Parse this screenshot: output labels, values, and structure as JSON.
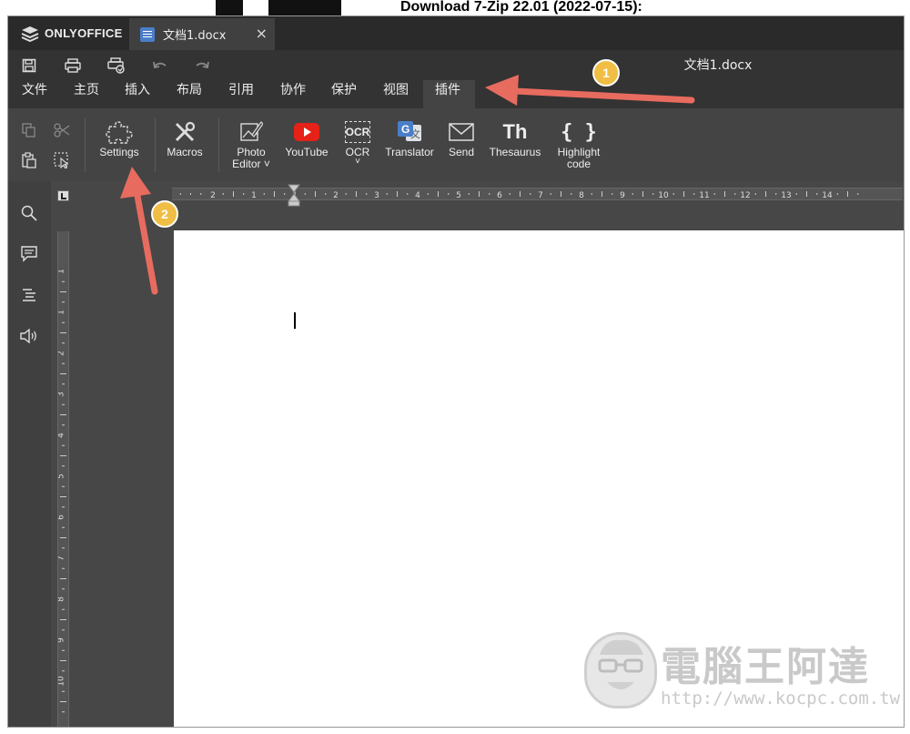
{
  "top_strip": {
    "text": "Download 7-Zip 22.01 (2022-07-15):"
  },
  "app": {
    "brand": "ONLYOFFICE"
  },
  "tab": {
    "title": "文档1.docx",
    "close_symbol": "×"
  },
  "quickbar": {
    "title": "文档1.docx",
    "icons": [
      "save-icon",
      "print-icon",
      "quick-print-icon",
      "undo-icon",
      "redo-icon"
    ]
  },
  "menu": {
    "items": [
      "文件",
      "主页",
      "插入",
      "布局",
      "引用",
      "协作",
      "保护",
      "视图",
      "插件"
    ],
    "active": "插件"
  },
  "toolbar": {
    "settings": "Settings",
    "macros": "Macros",
    "photo_editor_1": "Photo",
    "photo_editor_2": "Editor",
    "youtube": "YouTube",
    "ocr": "OCR",
    "ocr_icon_text": "OCR",
    "translator": "Translator",
    "send": "Send",
    "thesaurus": "Thesaurus",
    "thesaurus_icon_text": "Th",
    "highlight_1": "Highlight",
    "highlight_2": "code",
    "highlight_icon_text": "{ }"
  },
  "ruler": {
    "h_labels": [
      "2",
      "1",
      "1",
      "2",
      "3",
      "4",
      "5",
      "6",
      "7",
      "8",
      "9",
      "10",
      "11",
      "12",
      "13",
      "14"
    ],
    "v_labels": [
      "1",
      "1",
      "2",
      "3",
      "4",
      "5",
      "6",
      "7",
      "8",
      "9",
      "10"
    ]
  },
  "annotations": {
    "badge1": "1",
    "badge2": "2"
  },
  "watermark": {
    "title": "電腦王阿達",
    "url": "http://www.kocpc.com.tw"
  },
  "colors": {
    "chrome_dark": "#333333",
    "toolbar": "#444444",
    "accent_arrow": "#e86b5f",
    "badge": "#f0be45",
    "youtube": "#e62117",
    "translate_blue": "#4a7ec9"
  }
}
